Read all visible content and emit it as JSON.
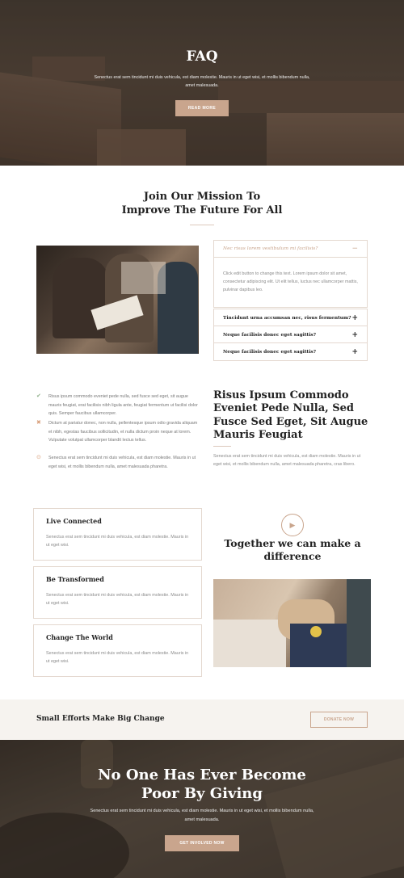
{
  "hero": {
    "title": "FAQ",
    "text": "Senectus erat sem tincidunt mi duis vehicula, est diam molestie. Mauris in ut eget wisi, et mollis bibendum nulla, amet malesuada.",
    "button_label": "READ MORE"
  },
  "mission": {
    "title_line1": "Join Our Mission To",
    "title_line2": "Improve The Future For All"
  },
  "accordion": {
    "items": [
      {
        "title": "Nec risus lorem vestibulum mi facilisis?",
        "icon": "minus-icon",
        "expanded": true,
        "body": "Click edit button to change this text. Lorem ipsum dolor sit amet, consectetur adipiscing elit. Ut elit tellus, luctus nec ullamcorper mattis, pulvinar dapibus leo."
      },
      {
        "title": "Tincidunt urna accumsan nec, risus fermentum?",
        "icon": "plus-icon",
        "expanded": false
      },
      {
        "title": "Neque facilisis donec eget sagittis?",
        "icon": "plus-icon",
        "expanded": false
      },
      {
        "title": "Neque facilisis donec eget sagittis?",
        "icon": "plus-icon",
        "expanded": false
      }
    ]
  },
  "checklist": {
    "items": [
      {
        "icon": "check-icon",
        "icon_glyph": "✔",
        "color": "#8fb08a",
        "text": "Risus ipsum commodo eveniet pede nulla, sed fusce sed eget, sit augue mauris feugiat, erat facilisis nibh ligula ante, feugiat fermentum ut facilisi dolor quis. Semper faucibus ullamcorper."
      },
      {
        "icon": "cross-icon",
        "icon_glyph": "✖",
        "color": "#d9a07c",
        "text": "Dictum at pariatur donec, non nulla, pellentesque ipsum odio gravida aliquam et nibh, egestas faucibus sollicitudin, et nulla dictum proin neque at lorem. Vulputate volutpat ullamcorper blandit lectus tellus."
      },
      {
        "icon": "target-icon",
        "icon_glyph": "⊙",
        "color": "#d9a07c",
        "text": "Senectus erat sem tincidunt mi duis vehicula, est diam molestie. Mauris in ut eget wisi, et mollis bibendum nulla, amet malesuada pharetra."
      }
    ]
  },
  "risus": {
    "title": "Risus Ipsum Commodo Eveniet Pede Nulla, Sed Fusce Sed Eget, Sit Augue Mauris Feugiat",
    "text": "Senectus erat sem tincidunt mi duis vehicula, est diam molestie. Mauris in ut eget wisi, et mollis bibendum nulla, amet malesuada pharetra, cras libero."
  },
  "features": [
    {
      "title": "Live Connected",
      "text": "Senectus erat sem tincidunt mi duis vehicula, est diam molestie. Mauris in ut eget wisi."
    },
    {
      "title": "Be Transformed",
      "text": "Senectus erat sem tincidunt mi duis vehicula, est diam molestie. Mauris in ut eget wisi."
    },
    {
      "title": "Change The World",
      "text": "Senectus erat sem tincidunt mi duis vehicula, est diam molestie. Mauris in ut eget wisi."
    }
  ],
  "together": {
    "title_line1": "Together we can make a",
    "title_line2": "difference"
  },
  "banner": {
    "title": "Small Efforts Make Big Change",
    "button_label": "DONATE NOW"
  },
  "footer_hero": {
    "title_line1": "No One Has Ever Become",
    "title_line2": "Poor By Giving",
    "text": "Senectus erat sem tincidunt mi duis vehicula, est diam molestie. Mauris in ut eget wisi, et mollis bibendum nulla, amet malesuada.",
    "button_label": "GET INVOLVED NOW"
  },
  "colors": {
    "accent": "#c9a58d",
    "heading": "#222222",
    "body_text": "#8a8a8a",
    "banner_bg": "#f6f3ef"
  }
}
